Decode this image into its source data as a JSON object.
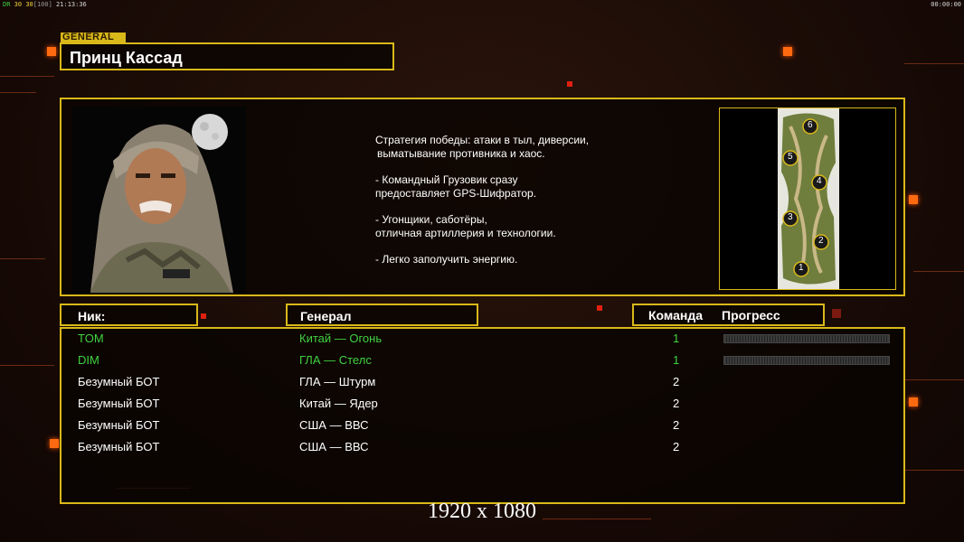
{
  "hud": {
    "left_prefix": "DR",
    "fps1": "30",
    "fps2": "30",
    "fps_limit": "[100]",
    "clock": "21:13:36",
    "right_timer": "00:00:00"
  },
  "general_tag": "GENERAL",
  "general_name": "Принц Кассад",
  "strategy": {
    "line1": "Стратегия победы: атаки в тыл, диверсии,",
    "line2": "выматывание противника и хаос.",
    "line3": "- Командный Грузовик сразу",
    "line4": "предоставляет GPS-Шифратор.",
    "line5": "- Угонщики, саботёры,",
    "line6": "отличная артиллерия и технологии.",
    "line7": "- Легко заполучить энергию."
  },
  "map": {
    "spawns": [
      "6",
      "5",
      "4",
      "3",
      "2",
      "1"
    ]
  },
  "columns": {
    "nick": "Ник:",
    "general": "Генерал",
    "team": "Команда",
    "progress": "Прогресс"
  },
  "players": [
    {
      "nick": "TOM",
      "general": "Китай — Огонь",
      "team": "1",
      "progress": 0.0
    },
    {
      "nick": "DIM",
      "general": "ГЛА — Стелс",
      "team": "1",
      "progress": 0.0
    },
    {
      "nick": "Безумный БОТ",
      "general": "ГЛА — Штурм",
      "team": "2"
    },
    {
      "nick": "Безумный БОТ",
      "general": "Китай — Ядер",
      "team": "2"
    },
    {
      "nick": "Безумный БОТ",
      "general": "США — ВВС",
      "team": "2"
    },
    {
      "nick": "Безумный БОТ",
      "general": "США — ВВС",
      "team": "2"
    }
  ],
  "resolution_caption": "1920 x 1080",
  "colors": {
    "accent": "#d9b81a",
    "human_player": "#3fd23f",
    "bot_player": "#ffffff",
    "deco": "#ff6a10"
  }
}
